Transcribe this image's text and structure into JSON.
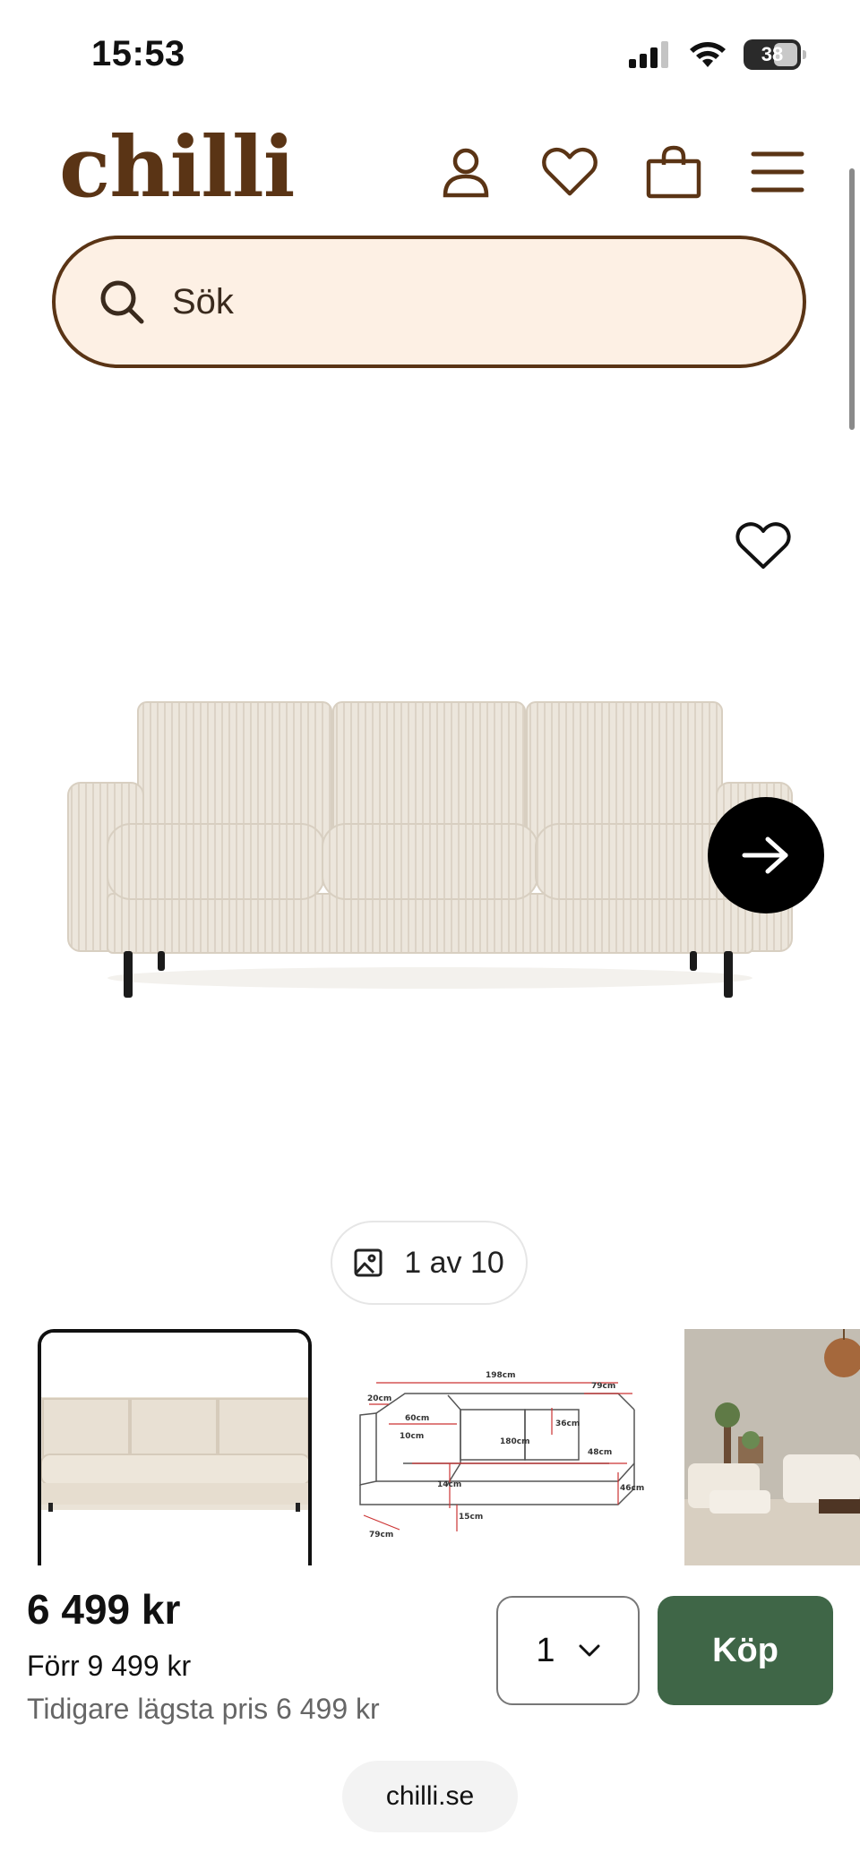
{
  "status_bar": {
    "time": "15:53",
    "battery": "38",
    "icons": [
      "signal-icon",
      "wifi-icon",
      "battery-icon"
    ]
  },
  "header": {
    "logo": "chilli",
    "icons": [
      "account-icon",
      "heart-icon",
      "bag-icon",
      "menu-icon"
    ]
  },
  "search": {
    "placeholder": "Sök"
  },
  "gallery": {
    "counter": "1 av 10",
    "thumbnails": [
      "sofa-front",
      "sofa-dimensions",
      "sofa-room"
    ],
    "dimensions": {
      "width_top": "198cm",
      "arm_depth": "79cm",
      "arm_height": "20cm",
      "seat_depth": "60cm",
      "back": "36cm",
      "cushion": "10cm",
      "seat_width": "180cm",
      "seat_height": "48cm",
      "leg": "14cm",
      "base": "15cm",
      "height": "46cm",
      "depth": "79cm"
    }
  },
  "purchase": {
    "price": "6 499 kr",
    "old_price": "Förr 9 499 kr",
    "lowest_price": "Tidigare lägsta pris 6 499 kr",
    "quantity": "1",
    "buy_label": "Köp"
  },
  "browser": {
    "url": "chilli.se"
  },
  "colors": {
    "brand_brown": "#5a3415",
    "search_bg": "#fdf0e4",
    "buy_green": "#3f6647"
  }
}
